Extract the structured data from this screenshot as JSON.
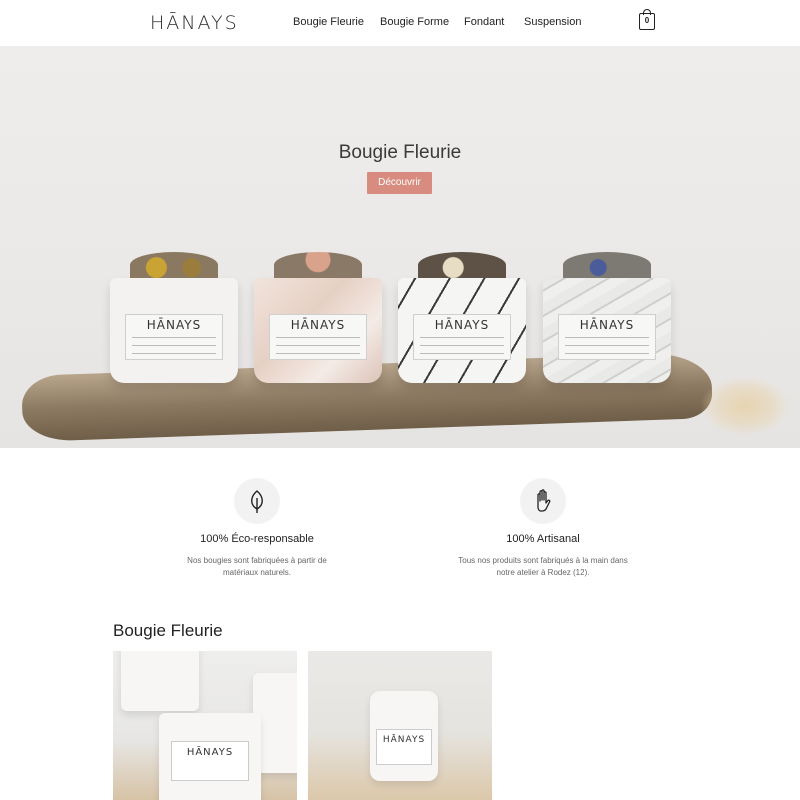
{
  "header": {
    "logo": "HĀNAYS",
    "nav": [
      "Bougie Fleurie",
      "Bougie Forme",
      "Fondant",
      "Suspension"
    ],
    "cart_count": "0"
  },
  "hero": {
    "title": "Bougie Fleurie",
    "button": "Découvrir",
    "candle_label_logo": "HĀNAYS"
  },
  "features": [
    {
      "icon": "leaf-icon",
      "title": "100% Éco-responsable",
      "text_line1": "Nos bougies sont fabriquées à partir de",
      "text_line2": "matériaux naturels."
    },
    {
      "icon": "hand-icon",
      "title": "100% Artisanal",
      "text_line1": "Tous nos produits sont fabriqués à la main dans",
      "text_line2": "notre atelier à Rodez (12)."
    }
  ],
  "section": {
    "title": "Bougie Fleurie"
  },
  "product_label": "HĀNAYS",
  "colors": {
    "accent": "#d88c7f",
    "text": "#222222",
    "feature_bg": "#f2f2f2"
  }
}
